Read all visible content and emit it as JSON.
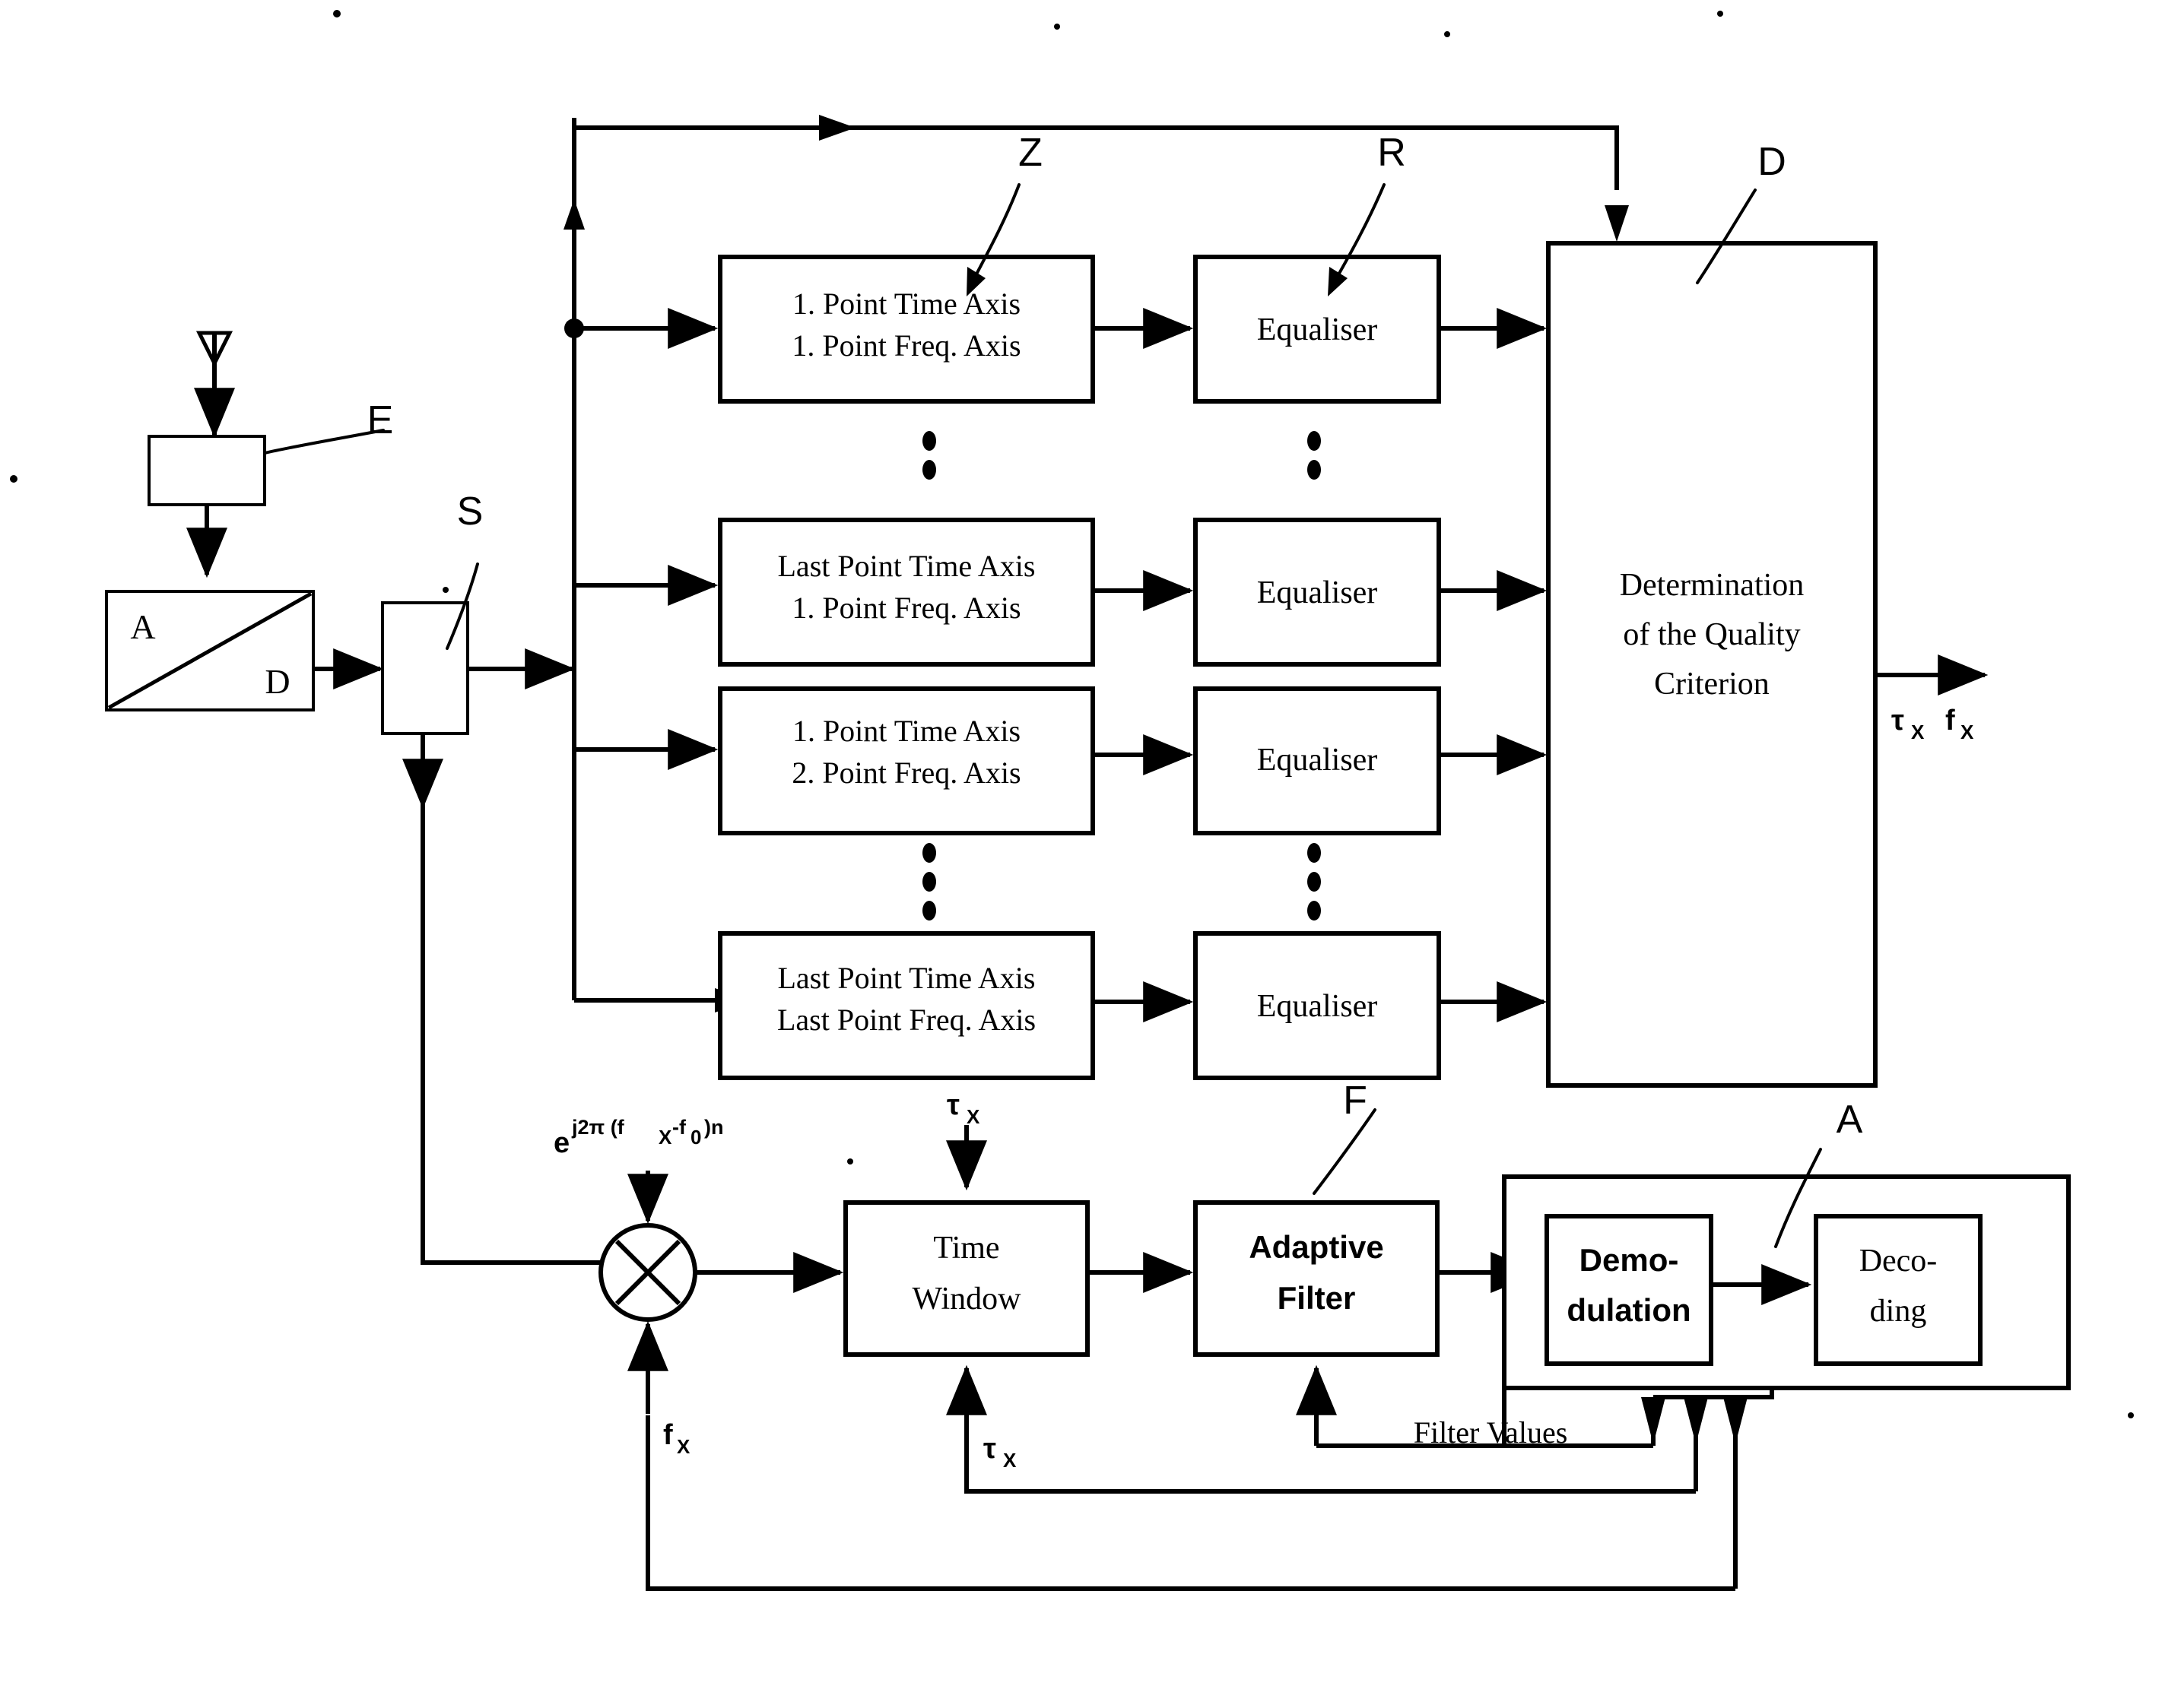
{
  "figure": {
    "type": "patent-block-diagram",
    "background": "#ffffff",
    "ink": "#000000"
  },
  "reference_labels": {
    "input_filter": "E",
    "selector": "S",
    "transform_bank": "Z",
    "equaliser_bank": "R",
    "determination": "D",
    "adaptive_filter": "F",
    "decoder_group": "A"
  },
  "blocks": {
    "ad_converter": {
      "left_label": "A",
      "right_label": "D"
    },
    "transform_stages": [
      {
        "line1": "1. Point Time Axis",
        "line2": "1. Point Freq. Axis"
      },
      {
        "line1": "Last Point Time Axis",
        "line2": "1. Point Freq. Axis"
      },
      {
        "line1": "1. Point Time Axis",
        "line2": "2. Point Freq. Axis"
      },
      {
        "line1": "Last Point Time Axis",
        "line2": "Last Point Freq. Axis"
      }
    ],
    "equalisers": [
      "Equaliser",
      "Equaliser",
      "Equaliser",
      "Equaliser"
    ],
    "determination": {
      "line1": "Determination",
      "line2": "of the Quality",
      "line3": "Criterion"
    },
    "time_window": {
      "line1": "Time",
      "line2": "Window"
    },
    "adaptive_filter": {
      "line1": "Adaptive",
      "line2": "Filter"
    },
    "demodulation": {
      "line1": "Demo-",
      "line2": "dulation"
    },
    "decoding": {
      "line1": "Deco-",
      "line2": "ding"
    }
  },
  "signal_labels": {
    "mixer_exponent": {
      "base": "e",
      "exponent": "j2π (f",
      "exponent_sub1": "X",
      "exponent_mid": "-f",
      "exponent_sub2": "0",
      "exponent_tail": ")n"
    },
    "tau_top": {
      "sym": "τ",
      "sub": "X"
    },
    "tau_bottom": {
      "sym": "τ",
      "sub": "X"
    },
    "f_bottom": {
      "sym": "f",
      "sub": "X"
    },
    "output_tau": {
      "sym": "τ",
      "sub": "X"
    },
    "output_f": {
      "sym": "f",
      "sub": "X"
    },
    "filter_values": "Filter Values"
  },
  "ellipsis": {
    "glyph": "•"
  }
}
